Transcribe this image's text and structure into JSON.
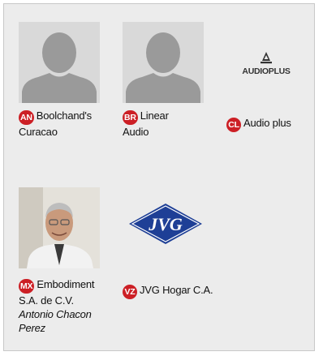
{
  "dealers": [
    {
      "code": "AN",
      "name_line1": "Boolchand's",
      "name_line2": "Curacao",
      "contact": "",
      "image": "person-placeholder-icon"
    },
    {
      "code": "BR",
      "name_line1": "Linear",
      "name_line2": "Audio",
      "contact": "",
      "image": "person-placeholder-icon"
    },
    {
      "code": "CL",
      "name_line1": "Audio plus",
      "name_line2": "",
      "contact": "",
      "image": "audioplus-logo"
    },
    {
      "code": "MX",
      "name_line1": "Embodiment",
      "name_line2": "S.A. de C.V.",
      "contact_line1": "Antonio Chacon",
      "contact_line2": "Perez",
      "image": "person-photo"
    },
    {
      "code": "VZ",
      "name_line1": "JVG Hogar C.A.",
      "name_line2": "",
      "contact": "",
      "image": "jvg-logo"
    }
  ],
  "logos": {
    "audioplus_text": "AUDIOPLUS",
    "jvg_text": "JVG"
  },
  "colors": {
    "badge": "#cc1f25",
    "panel_bg": "#ececec",
    "placeholder_bg": "#d9d9d9",
    "placeholder_figure": "#9a9a9a",
    "jvg_blue": "#1e3f96"
  }
}
